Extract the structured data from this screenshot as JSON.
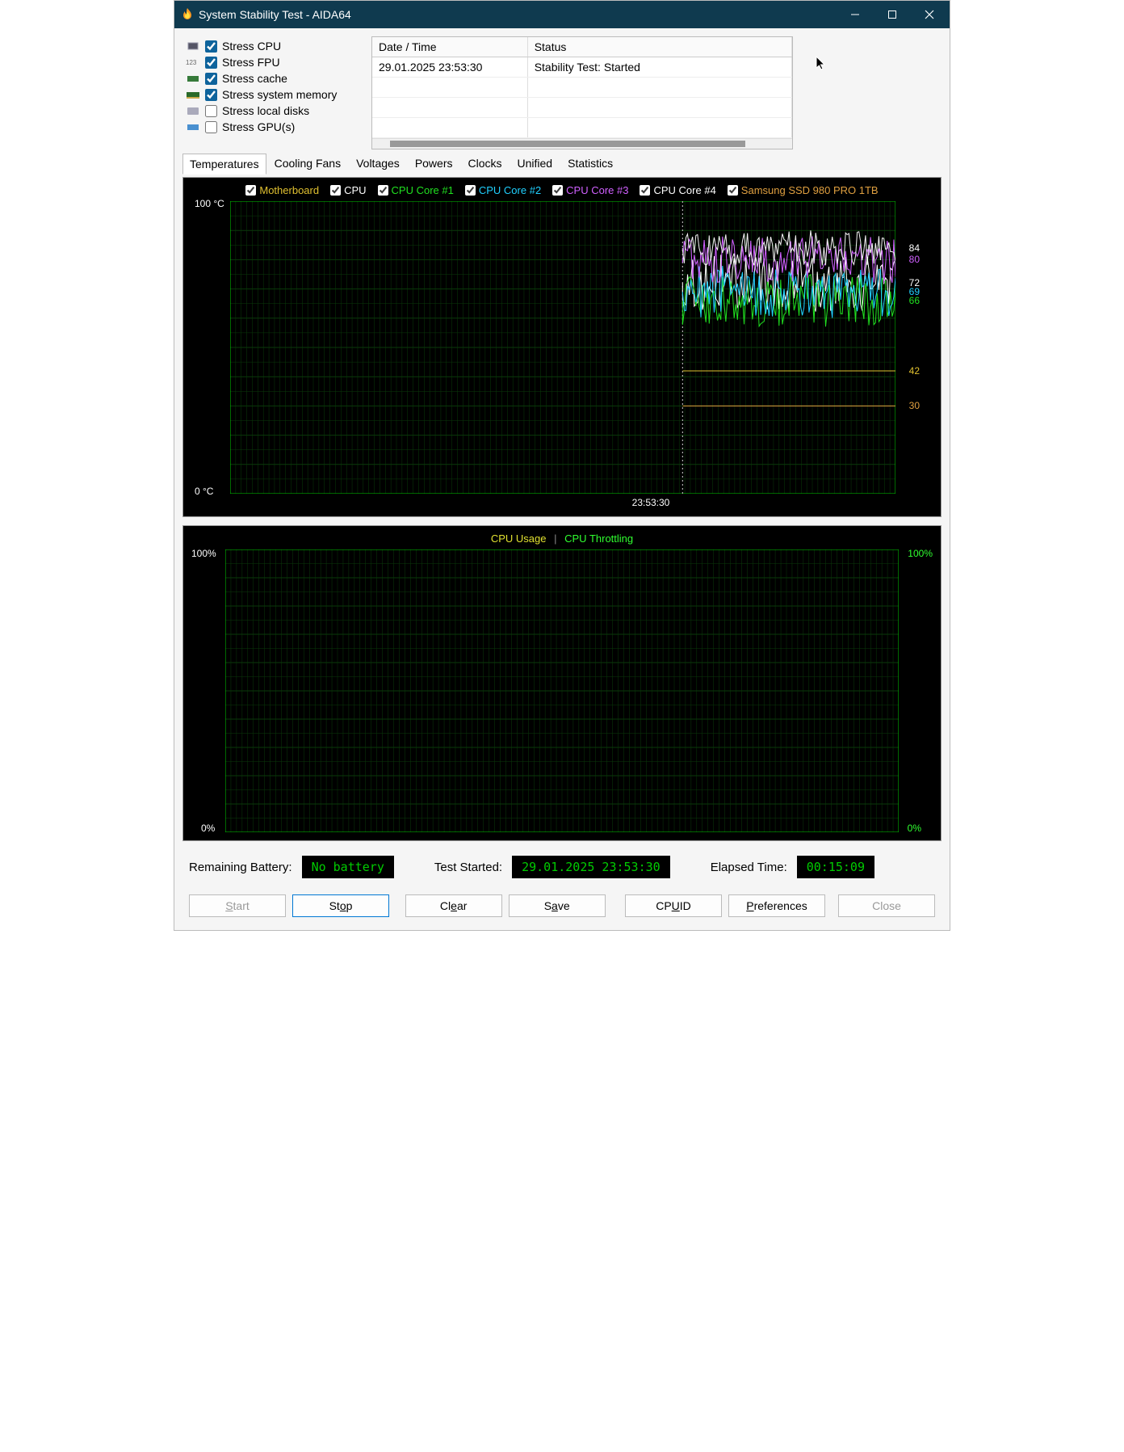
{
  "window": {
    "title": "System Stability Test - AIDA64"
  },
  "stress": {
    "items": [
      {
        "label": "Stress CPU",
        "checked": true,
        "icon": "cpu"
      },
      {
        "label": "Stress FPU",
        "checked": true,
        "icon": "fpu"
      },
      {
        "label": "Stress cache",
        "checked": true,
        "icon": "cache"
      },
      {
        "label": "Stress system memory",
        "checked": true,
        "icon": "ram"
      },
      {
        "label": "Stress local disks",
        "checked": false,
        "icon": "disk"
      },
      {
        "label": "Stress GPU(s)",
        "checked": false,
        "icon": "gpu"
      }
    ]
  },
  "log": {
    "headers": [
      "Date / Time",
      "Status"
    ],
    "rows": [
      {
        "date": "29.01.2025 23:53:30",
        "status": "Stability Test: Started"
      }
    ]
  },
  "tabs": [
    "Temperatures",
    "Cooling Fans",
    "Voltages",
    "Powers",
    "Clocks",
    "Unified",
    "Statistics"
  ],
  "active_tab": "Temperatures",
  "chart_data": [
    {
      "type": "line",
      "title": "",
      "ylabel": "°C",
      "ylim": [
        0,
        100
      ],
      "x_marker_label": "23:53:30",
      "x_marker_frac": 0.68,
      "series": [
        {
          "name": "Motherboard",
          "color": "#e0c030",
          "value": 42
        },
        {
          "name": "CPU",
          "color": "#ffffff",
          "value": 84
        },
        {
          "name": "CPU Core #1",
          "color": "#20e020",
          "value": 66
        },
        {
          "name": "CPU Core #2",
          "color": "#20d0ff",
          "value": 69
        },
        {
          "name": "CPU Core #3",
          "color": "#d060ff",
          "value": 80
        },
        {
          "name": "CPU Core #4",
          "color": "#ffffff",
          "value": 72
        },
        {
          "name": "Samsung SSD 980 PRO 1TB",
          "color": "#e0a040",
          "value": 30
        }
      ]
    },
    {
      "type": "line",
      "ylabel_left_top": "100%",
      "ylabel_left_bot": "0%",
      "ylabel_right_top": "100%",
      "ylabel_right_bot": "0%",
      "legend": [
        {
          "name": "CPU Usage",
          "color": "#e0e030"
        },
        {
          "name": "CPU Throttling",
          "color": "#30ff30"
        }
      ],
      "separator": "|"
    }
  ],
  "status": {
    "battery_label": "Remaining Battery:",
    "battery_value": "No battery",
    "started_label": "Test Started:",
    "started_value": "29.01.2025 23:53:30",
    "elapsed_label": "Elapsed Time:",
    "elapsed_value": "00:15:09"
  },
  "buttons": {
    "start": "Start",
    "stop": "Stop",
    "clear": "Clear",
    "save": "Save",
    "cpuid": "CPUID",
    "prefs": "Preferences",
    "close": "Close"
  }
}
